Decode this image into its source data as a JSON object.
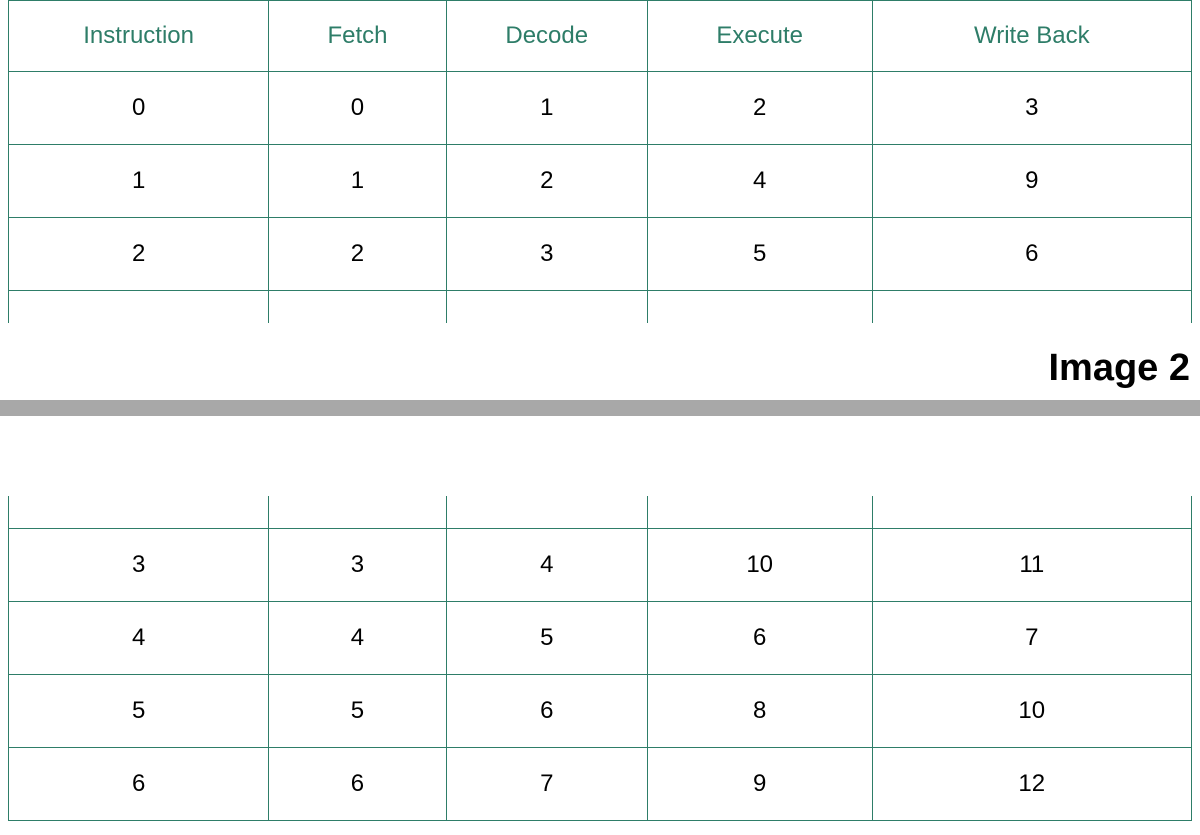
{
  "headers": {
    "instruction": "Instruction",
    "fetch": "Fetch",
    "decode": "Decode",
    "execute": "Execute",
    "writeback": "Write Back"
  },
  "table1": {
    "rows": [
      {
        "instruction": "0",
        "fetch": "0",
        "decode": "1",
        "execute": "2",
        "writeback": "3"
      },
      {
        "instruction": "1",
        "fetch": "1",
        "decode": "2",
        "execute": "4",
        "writeback": "9"
      },
      {
        "instruction": "2",
        "fetch": "2",
        "decode": "3",
        "execute": "5",
        "writeback": "6"
      }
    ]
  },
  "image_label": "Image 2",
  "table2": {
    "rows": [
      {
        "instruction": "3",
        "fetch": "3",
        "decode": "4",
        "execute": "10",
        "writeback": "11"
      },
      {
        "instruction": "4",
        "fetch": "4",
        "decode": "5",
        "execute": "6",
        "writeback": "7"
      },
      {
        "instruction": "5",
        "fetch": "5",
        "decode": "6",
        "execute": "8",
        "writeback": "10"
      },
      {
        "instruction": "6",
        "fetch": "6",
        "decode": "7",
        "execute": "9",
        "writeback": "12"
      }
    ]
  }
}
